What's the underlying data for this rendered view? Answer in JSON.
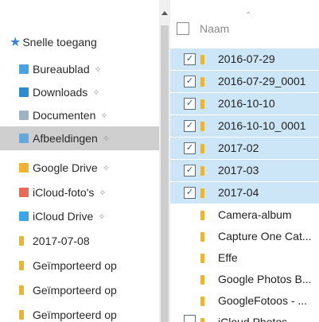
{
  "nav": {
    "quick_access": "Snelle toegang",
    "items": [
      {
        "label": "Bureaublad",
        "icon": "desktop-icon",
        "color": "#4aa3df",
        "pinned": true
      },
      {
        "label": "Downloads",
        "icon": "downloads-icon",
        "color": "#2f8ad0",
        "pinned": true
      },
      {
        "label": "Documenten",
        "icon": "documents-icon",
        "color": "#9fb3c3",
        "pinned": true
      },
      {
        "label": "Afbeeldingen",
        "icon": "pictures-icon",
        "color": "#63a8d8",
        "pinned": true,
        "selected": true
      },
      {
        "label": "Google Drive",
        "icon": "google-drive-icon",
        "color": "#f2b233",
        "pinned": true
      },
      {
        "label": "iCloud-foto's",
        "icon": "icloud-photos-icon",
        "color": "#e86b5a",
        "pinned": true
      },
      {
        "label": "iCloud Drive",
        "icon": "icloud-drive-icon",
        "color": "#3da6e8",
        "pinned": true
      },
      {
        "label": "2017-07-08",
        "icon": "folder-icon",
        "color": "#e6b53e",
        "pinned": false
      },
      {
        "label": "Geïmporteerd op",
        "icon": "folder-icon",
        "color": "#e6b53e",
        "pinned": false
      },
      {
        "label": "Geïmporteerd op",
        "icon": "folder-icon",
        "color": "#e6b53e",
        "pinned": false
      },
      {
        "label": "Geïmporteerd op",
        "icon": "folder-icon",
        "color": "#e6b53e",
        "pinned": false
      }
    ]
  },
  "list": {
    "column_name": "Naam",
    "rows": [
      {
        "name": "2016-07-29",
        "selected": true,
        "checked": true
      },
      {
        "name": "2016-07-29_0001",
        "selected": true,
        "checked": true
      },
      {
        "name": "2016-10-10",
        "selected": true,
        "checked": true
      },
      {
        "name": "2016-10-10_0001",
        "selected": true,
        "checked": true
      },
      {
        "name": "2017-02",
        "selected": true,
        "checked": true
      },
      {
        "name": "2017-03",
        "selected": true,
        "checked": true
      },
      {
        "name": "2017-04",
        "selected": true,
        "checked": true
      },
      {
        "name": "Camera-album",
        "selected": false,
        "checked": false
      },
      {
        "name": "Capture One Cat...",
        "selected": false,
        "checked": false
      },
      {
        "name": "Effe",
        "selected": false,
        "checked": false
      },
      {
        "name": "Google Photos B...",
        "selected": false,
        "checked": false
      },
      {
        "name": "GoogleFotoos - ...",
        "selected": false,
        "checked": false
      },
      {
        "name": "iCloud Photos",
        "selected": false,
        "checked": false
      }
    ]
  },
  "colors": {
    "selection": "#cde6f7",
    "nav_selection": "#cfcfcf",
    "folder": "#e6b53e",
    "accent": "#3a86d4"
  }
}
